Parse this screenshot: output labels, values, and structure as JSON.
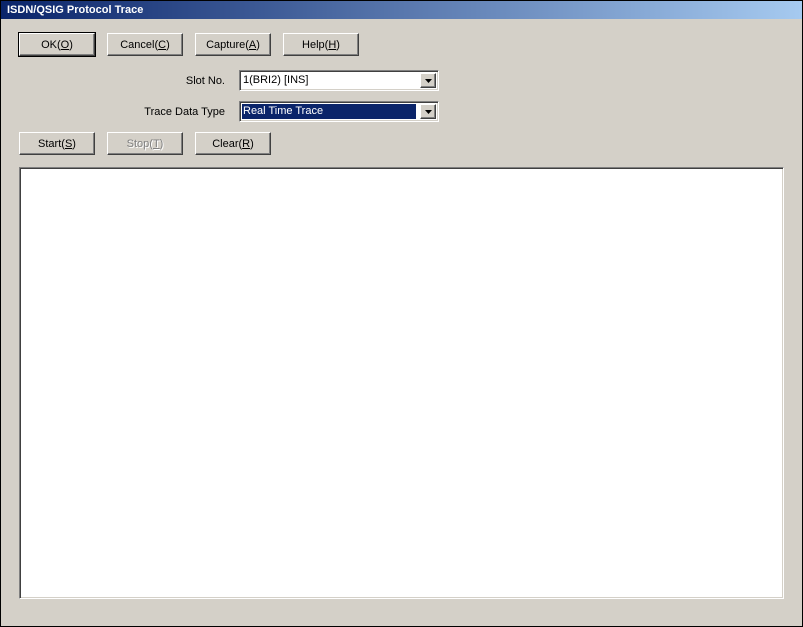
{
  "window": {
    "title": "ISDN/QSIG Protocol Trace"
  },
  "buttons": {
    "ok": {
      "pre": "OK(",
      "accel": "O",
      "post": ")"
    },
    "cancel": {
      "pre": "Cancel(",
      "accel": "C",
      "post": ")"
    },
    "capture": {
      "pre": "Capture(",
      "accel": "A",
      "post": ")"
    },
    "help": {
      "pre": "Help(",
      "accel": "H",
      "post": ")"
    },
    "start": {
      "pre": "Start(",
      "accel": "S",
      "post": ")"
    },
    "stop": {
      "pre": "Stop(",
      "accel": "T",
      "post": ")"
    },
    "clear": {
      "pre": "Clear(",
      "accel": "R",
      "post": ")"
    }
  },
  "form": {
    "slot_label": "Slot No.",
    "slot_value": "1(BRI2) [INS]",
    "trace_type_label": "Trace Data Type",
    "trace_type_value": "Real Time Trace"
  }
}
